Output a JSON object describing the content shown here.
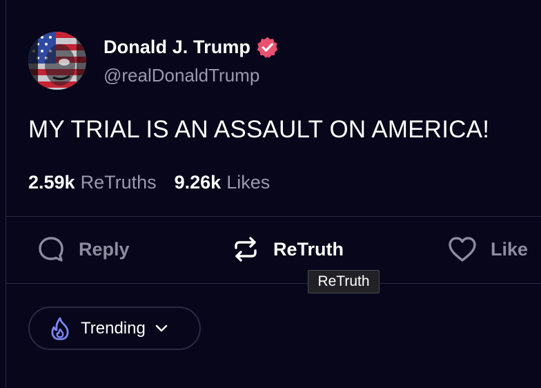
{
  "post": {
    "author": {
      "display_name": "Donald J. Trump",
      "handle": "@realDonaldTrump",
      "verified_icon": "verified-badge-icon",
      "verified_color": "#e8506f"
    },
    "text": "MY TRIAL IS AN ASSAULT ON AMERICA!",
    "stats": {
      "retruths_count": "2.59k",
      "retruths_label": "ReTruths",
      "likes_count": "9.26k",
      "likes_label": "Likes"
    }
  },
  "actions": {
    "reply_label": "Reply",
    "retruth_label": "ReTruth",
    "like_label": "Like"
  },
  "tooltip": {
    "text": "ReTruth"
  },
  "feed_filter": {
    "label": "Trending",
    "icon": "flame-icon",
    "accent": "#7b86f5"
  },
  "colors": {
    "background": "#07061a",
    "muted_text": "#9a9aae",
    "divider": "#2a2940"
  }
}
